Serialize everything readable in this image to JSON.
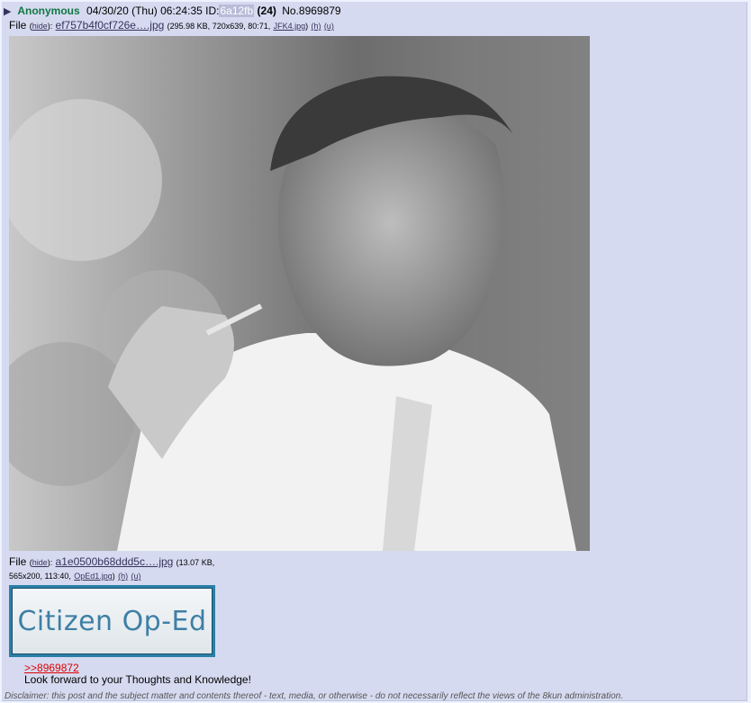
{
  "post": {
    "arrow": "▶",
    "name": "Anonymous",
    "datetime": "04/30/20 (Thu) 06:24:35",
    "id_label": "ID:",
    "poster_id": "6a12fb",
    "poster_id_color": "#b8bcd8",
    "post_count": "(24)",
    "post_number": "No.8969879"
  },
  "files": [
    {
      "label": "File",
      "hide": "hide",
      "filename": "ef757b4f0cf726e….jpg",
      "details": "(295.98 KB, 720x639, 80:71,",
      "original_name": "JFK4.jpg",
      "h": "(h)",
      "u": "(u)"
    },
    {
      "label": "File",
      "hide": "hide",
      "filename": "a1e0500b68ddd5c….jpg",
      "details_line1": "(13.07 KB,",
      "details_line2": "565x200, 113:40,",
      "original_name": "OpEd1.jpg",
      "h": "(h)",
      "u": "(u)",
      "image_text": "Citizen Op-Ed"
    }
  ],
  "body": {
    "quote_link": ">>8969872",
    "message": "Look forward to your Thoughts and Knowledge!"
  },
  "disclaimer": "Disclaimer: this post and the subject matter and contents thereof - text, media, or otherwise - do not necessarily reflect the views of the 8kun administration."
}
